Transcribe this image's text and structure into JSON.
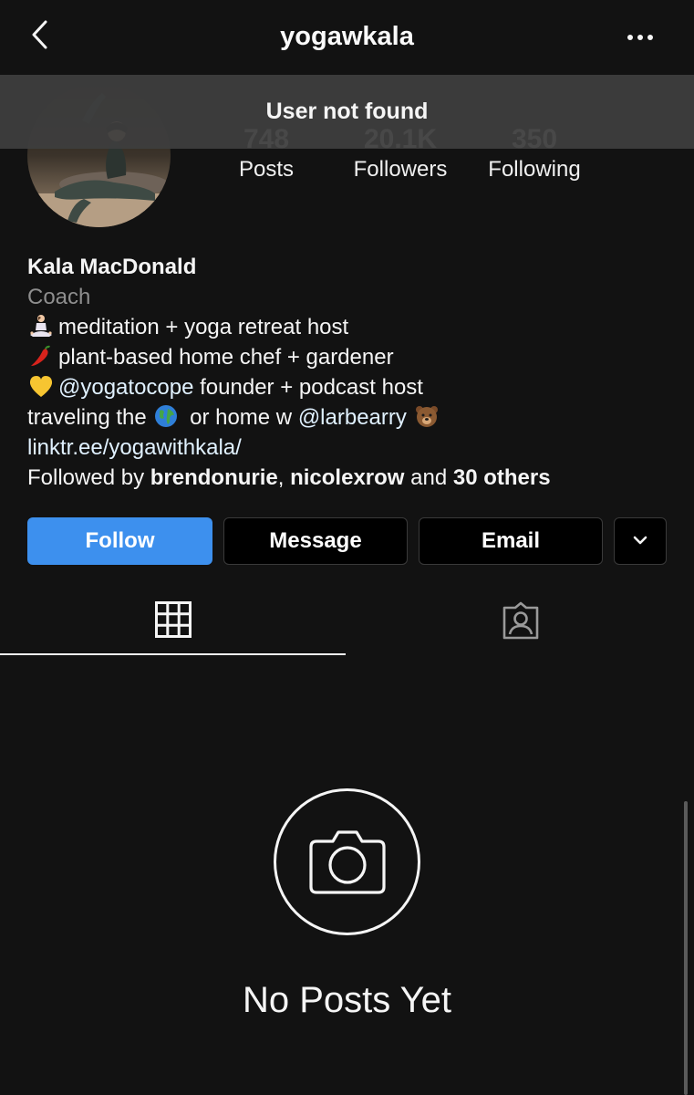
{
  "header": {
    "username": "yogawkala"
  },
  "toast": {
    "message": "User not found"
  },
  "stats": [
    {
      "value": "748",
      "label": "Posts"
    },
    {
      "value": "20.1K",
      "label": "Followers"
    },
    {
      "value": "350",
      "label": "Following"
    }
  ],
  "bio": {
    "name": "Kala MacDonald",
    "category": "Coach",
    "line1": "meditation + yoga retreat host",
    "line2": "plant-based home chef + gardener",
    "line3_mention": "@yogatocope",
    "line3_rest": " founder + podcast host",
    "line4_start": "traveling the ",
    "line4_mid": " or home w ",
    "line4_mention": "@larbearry",
    "link": "linktr.ee/yogawithkala/",
    "followed_prefix": "Followed by ",
    "followed_user1": "brendonurie",
    "followed_sep": ", ",
    "followed_user2": "nicolexrow",
    "followed_and": " and ",
    "followed_others": "30 others"
  },
  "buttons": {
    "follow": "Follow",
    "message": "Message",
    "email": "Email"
  },
  "empty_state": {
    "title": "No Posts Yet"
  },
  "colors": {
    "background": "#121212",
    "follow_button": "#3d90ee",
    "toast": "#3e3e3e",
    "muted_text": "#8e8e8e"
  },
  "icons": {
    "back": "chevron-left-icon",
    "more": "more-horizontal-icon",
    "grid": "grid-icon",
    "tagged": "tagged-person-icon",
    "camera": "camera-icon",
    "dropdown": "chevron-down-icon"
  }
}
